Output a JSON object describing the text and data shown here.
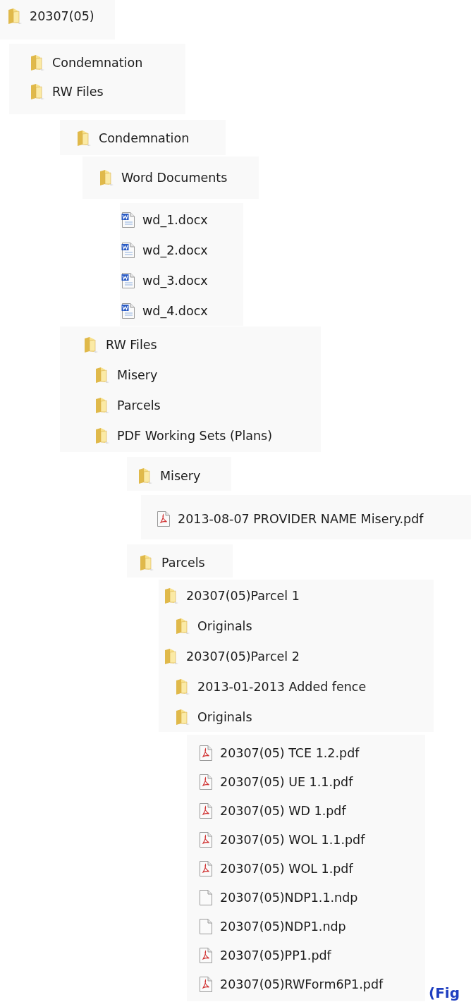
{
  "panels": [
    {
      "items": [
        {
          "kind": "folder",
          "name": "20307(05)"
        }
      ]
    },
    {
      "items": [
        {
          "kind": "folder",
          "name": "Condemnation"
        },
        {
          "kind": "folder",
          "name": "RW Files"
        }
      ]
    },
    {
      "items": [
        {
          "kind": "folder",
          "name": "Condemnation"
        }
      ]
    },
    {
      "items": [
        {
          "kind": "folder",
          "name": "Word Documents"
        }
      ]
    },
    {
      "items": [
        {
          "kind": "word",
          "name": "wd_1.docx"
        },
        {
          "kind": "word",
          "name": "wd_2.docx"
        },
        {
          "kind": "word",
          "name": "wd_3.docx"
        },
        {
          "kind": "word",
          "name": "wd_4.docx"
        }
      ]
    },
    {
      "items": [
        {
          "kind": "folder",
          "name": "RW Files",
          "children": [
            {
              "kind": "folder",
              "name": "Misery"
            },
            {
              "kind": "folder",
              "name": "Parcels"
            },
            {
              "kind": "folder",
              "name": "PDF Working Sets (Plans)"
            }
          ]
        }
      ]
    },
    {
      "items": [
        {
          "kind": "folder",
          "name": "Misery"
        }
      ]
    },
    {
      "items": [
        {
          "kind": "pdf",
          "name": "2013-08-07 PROVIDER NAME Misery.pdf"
        }
      ]
    },
    {
      "items": [
        {
          "kind": "folder",
          "name": "Parcels"
        }
      ]
    },
    {
      "items": [
        {
          "kind": "folder",
          "name": "20307(05)Parcel 1",
          "children": [
            {
              "kind": "folder",
              "name": "Originals"
            }
          ]
        },
        {
          "kind": "folder",
          "name": "20307(05)Parcel 2",
          "children": [
            {
              "kind": "folder",
              "name": "2013-01-2013 Added fence"
            },
            {
              "kind": "folder",
              "name": "Originals"
            }
          ]
        }
      ]
    },
    {
      "items": [
        {
          "kind": "pdf",
          "name": "20307(05) TCE 1.2.pdf"
        },
        {
          "kind": "pdf",
          "name": "20307(05) UE 1.1.pdf"
        },
        {
          "kind": "pdf",
          "name": "20307(05) WD 1.pdf"
        },
        {
          "kind": "pdf",
          "name": "20307(05) WOL 1.1.pdf"
        },
        {
          "kind": "pdf",
          "name": "20307(05) WOL 1.pdf"
        },
        {
          "kind": "file",
          "name": "20307(05)NDP1.1.ndp"
        },
        {
          "kind": "file",
          "name": "20307(05)NDP1.ndp"
        },
        {
          "kind": "pdf",
          "name": "20307(05)PP1.pdf"
        },
        {
          "kind": "pdf",
          "name": "20307(05)RWForm6P1.pdf"
        }
      ]
    }
  ],
  "caption": "(Fig"
}
